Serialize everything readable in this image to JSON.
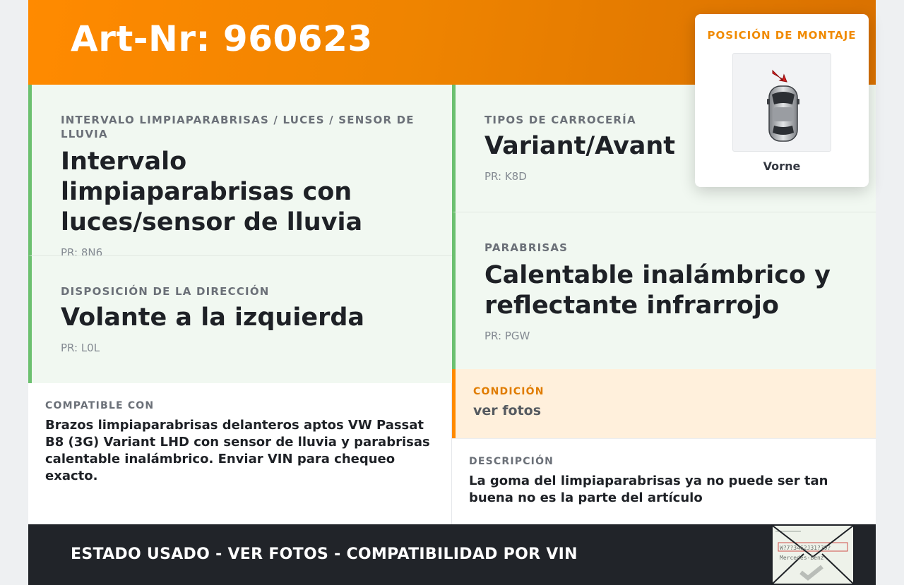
{
  "header": {
    "title": "Art-Nr: 960623"
  },
  "specs": {
    "wiper": {
      "label": "INTERVALO LIMPIAPARABRISAS / LUCES / SENSOR DE LLUVIA",
      "value": "Intervalo limpiaparabrisas con luces/sensor de lluvia",
      "pr": "PR: 8N6"
    },
    "steering": {
      "label": "DISPOSICIÓN DE LA DIRECCIÓN",
      "value": "Volante a la izquierda",
      "pr": "PR: L0L"
    },
    "body": {
      "label": "TIPOS DE CARROCERÍA",
      "value": "Variant/Avant",
      "pr": "PR: K8D"
    },
    "windshield": {
      "label": "PARABRISAS",
      "value": "Calentable inalámbrico y reflectante infrarrojo",
      "pr": "PR: PGW"
    }
  },
  "condition": {
    "label": "CONDICIÓN",
    "value": "ver fotos"
  },
  "compatible": {
    "label": "COMPATIBLE CON",
    "text": "Brazos limpiaparabrisas delanteros aptos VW Passat B8 (3G) Variant LHD con sensor de lluvia y parabrisas calentable inalámbrico. Enviar VIN para chequeo exacto."
  },
  "description": {
    "label": "DESCRIPCIÓN",
    "text": "La goma del limpiaparabrisas ya no puede ser tan buena no es la parte del artículo"
  },
  "footer": {
    "text": "ESTADO USADO - VER FOTOS - COMPATIBILIDAD POR VIN"
  },
  "position": {
    "title": "POSICIÓN DE MONTAJE",
    "caption": "Vorne",
    "image_icon": "car-top-view-icon",
    "arrow_color": "#d81e1e"
  },
  "stamp": {
    "icon": "envelope-stamp-icon",
    "vin": "W?7?3462J31??9?",
    "brand": "Mercedes-Benz"
  },
  "colors": {
    "accent": "#ff8a00",
    "spec_border": "#6cc070",
    "spec_bg": "#f1f8f1",
    "condition_bg": "#fff0dc",
    "footer_bg": "#212429"
  }
}
